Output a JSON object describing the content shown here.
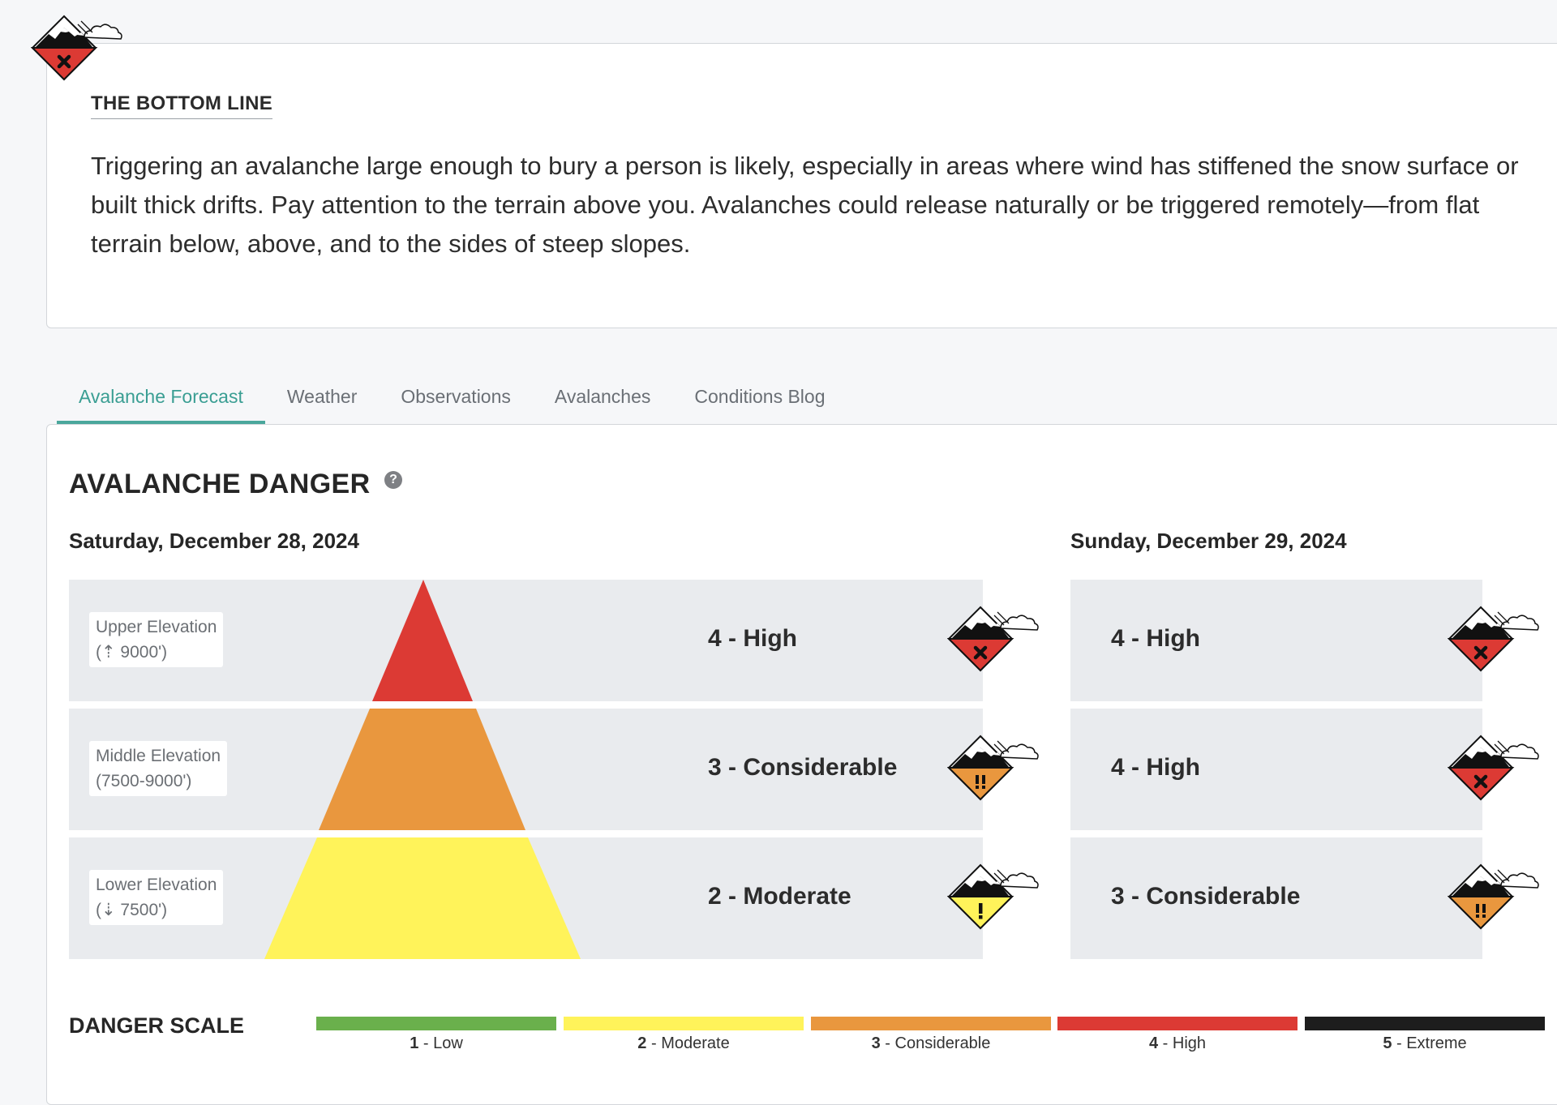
{
  "bottom_line": {
    "heading": "THE BOTTOM LINE",
    "text": "Triggering an avalanche large enough to bury a person is likely, especially in areas where wind has stiffened the snow surface or built thick drifts. Pay attention to the terrain above you. Avalanches could release naturally or be triggered remotely—from flat terrain below, above, and to the sides of steep slopes.",
    "icon": "danger-high-icon"
  },
  "tabs": [
    {
      "label": "Avalanche Forecast",
      "active": true
    },
    {
      "label": "Weather",
      "active": false
    },
    {
      "label": "Observations",
      "active": false
    },
    {
      "label": "Avalanches",
      "active": false
    },
    {
      "label": "Conditions Blog",
      "active": false
    }
  ],
  "danger": {
    "title": "AVALANCHE DANGER",
    "help_icon": "?",
    "elevations": [
      {
        "name": "Upper Elevation",
        "range": "(⇡ 9000')"
      },
      {
        "name": "Middle Elevation",
        "range": "(7500-9000')"
      },
      {
        "name": "Lower Elevation",
        "range": "(⇣ 7500')"
      }
    ],
    "days": [
      {
        "date": "Saturday, December 28, 2024",
        "ratings": [
          {
            "label": "4 - High",
            "level": 4
          },
          {
            "label": "3 - Considerable",
            "level": 3
          },
          {
            "label": "2 - Moderate",
            "level": 2
          }
        ]
      },
      {
        "date": "Sunday, December 29, 2024",
        "ratings": [
          {
            "label": "4 - High",
            "level": 4
          },
          {
            "label": "4 - High",
            "level": 4
          },
          {
            "label": "3 - Considerable",
            "level": 3
          }
        ]
      }
    ]
  },
  "scale": {
    "title": "DANGER SCALE",
    "levels": [
      {
        "num": "1",
        "name": " - Low",
        "color": "#6ab04c"
      },
      {
        "num": "2",
        "name": " - Moderate",
        "color": "#fff35a"
      },
      {
        "num": "3",
        "name": " - Considerable",
        "color": "#e9973e"
      },
      {
        "num": "4",
        "name": " - High",
        "color": "#dc3a34"
      },
      {
        "num": "5",
        "name": " - Extreme",
        "color": "#1d1d1d"
      }
    ]
  },
  "colors": {
    "low": "#6ab04c",
    "moderate": "#fff35a",
    "considerable": "#e9973e",
    "high": "#dc3a34",
    "extreme": "#1d1d1d",
    "accent": "#3a9e93"
  }
}
